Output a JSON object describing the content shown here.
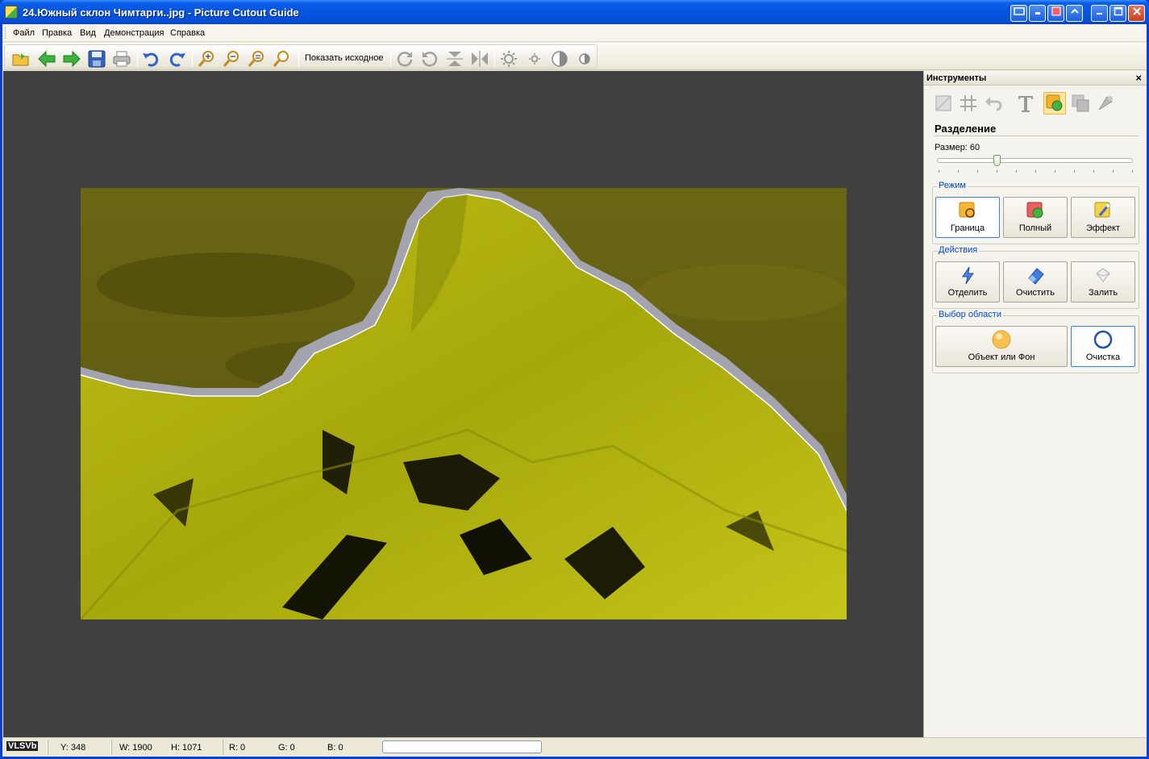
{
  "window": {
    "title": "24.Южный склон Чимтарги..jpg - Picture Cutout Guide"
  },
  "menu": {
    "items": [
      "Файл",
      "Правка",
      "Вид",
      "Демонстрация",
      "Справка"
    ]
  },
  "toolbar": {
    "show_original_label": "Показать исходное",
    "icons": [
      "open-folder-icon",
      "back-arrow-icon",
      "forward-arrow-icon",
      "save-icon",
      "print-icon",
      "undo-icon",
      "redo-icon",
      "zoom-in-icon",
      "zoom-out-icon",
      "zoom-fit-icon",
      "zoom-actual-icon",
      "rotate-right-icon",
      "rotate-left-icon",
      "flip-vertical-icon",
      "flip-horizontal-icon",
      "brightness-up-icon",
      "brightness-down-icon",
      "contrast-up-icon",
      "contrast-down-icon"
    ]
  },
  "panel": {
    "title": "Инструменты",
    "close_glyph": "×",
    "section_title": "Разделение",
    "size_label": "Размер: 60",
    "size_value": 60,
    "mode": {
      "label": "Режим",
      "buttons": [
        "Граница",
        "Полный",
        "Эффект"
      ]
    },
    "actions": {
      "label": "Действия",
      "buttons": [
        "Отделить",
        "Очистить",
        "Залить"
      ]
    },
    "area": {
      "label": "Выбор области",
      "buttons": [
        "Объект или Фон",
        "Очистка"
      ]
    }
  },
  "status": {
    "logo": "VLSVb",
    "y": "Y: 348",
    "w": "W: 1900",
    "h": "H: 1071",
    "r": "R: 0",
    "g": "G: 0",
    "b": "B: 0"
  },
  "colors": {
    "canvas_bg": "#404040",
    "selection_overlay": "#c8c814",
    "accent": "#0046d5"
  }
}
